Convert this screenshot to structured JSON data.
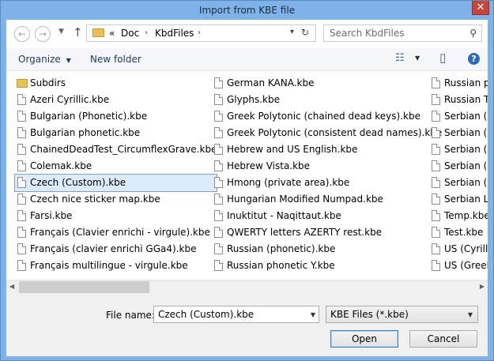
{
  "window": {
    "title": "Import from KBE file",
    "close_glyph": "✕"
  },
  "nav": {
    "back_glyph": "←",
    "forward_glyph": "→",
    "dropdown_glyph": "▼",
    "up_glyph": "↑",
    "breadcrumb_prefix": "«",
    "breadcrumb": [
      "Doc",
      "KbdFiles"
    ],
    "crumb_sep": "›",
    "address_drop": "▾",
    "refresh_glyph": "↻",
    "search_placeholder": "Search KbdFiles",
    "search_glyph": "⚲"
  },
  "toolbar": {
    "organize_label": "Organize",
    "organize_arrow": "▼",
    "new_folder_label": "New folder",
    "view_glyph": "☷",
    "view_arrow": "▼",
    "pane_glyph": "▯",
    "help_glyph": "?"
  },
  "files": {
    "col1": [
      {
        "name": "Subdirs",
        "type": "folder"
      },
      {
        "name": "Azeri Cyrillic.kbe",
        "type": "file"
      },
      {
        "name": "Bulgarian (Phonetic).kbe",
        "type": "file"
      },
      {
        "name": "Bulgarian phonetic.kbe",
        "type": "file"
      },
      {
        "name": "ChainedDeadTest_CircumflexGrave.kbe",
        "type": "file"
      },
      {
        "name": "Colemak.kbe",
        "type": "file"
      },
      {
        "name": "Czech (Custom).kbe",
        "type": "file",
        "selected": true
      },
      {
        "name": "Czech nice sticker map.kbe",
        "type": "file"
      },
      {
        "name": "Farsi.kbe",
        "type": "file"
      },
      {
        "name": "Français (Clavier enrichi - virgule).kbe",
        "type": "file"
      },
      {
        "name": "Français (clavier enrichi GGa4).kbe",
        "type": "file"
      },
      {
        "name": "Français multilingue - virgule.kbe",
        "type": "file"
      }
    ],
    "col2": [
      {
        "name": "German KANA.kbe",
        "type": "file"
      },
      {
        "name": "Glyphs.kbe",
        "type": "file"
      },
      {
        "name": "Greek Polytonic (chained dead keys).kbe",
        "type": "file"
      },
      {
        "name": "Greek Polytonic (consistent dead names).kbe",
        "type": "file"
      },
      {
        "name": "Hebrew and US English.kbe",
        "type": "file"
      },
      {
        "name": "Hebrew Vista.kbe",
        "type": "file"
      },
      {
        "name": "Hmong (private area).kbe",
        "type": "file"
      },
      {
        "name": "Hungarian Modified Numpad.kbe",
        "type": "file"
      },
      {
        "name": "Inuktitut - Naqittaut.kbe",
        "type": "file"
      },
      {
        "name": "QWERTY letters AZERTY rest.kbe",
        "type": "file"
      },
      {
        "name": "Russian (phonetic).kbe",
        "type": "file"
      },
      {
        "name": "Russian phonetic Y.kbe",
        "type": "file"
      }
    ],
    "col3": [
      {
        "name": "Russian pho",
        "type": "file"
      },
      {
        "name": "Russian Tes",
        "type": "file"
      },
      {
        "name": "Serbian (Cy",
        "type": "file"
      },
      {
        "name": "Serbian (Lat",
        "type": "file"
      },
      {
        "name": "Serbian (Lat",
        "type": "file"
      },
      {
        "name": "Serbian (Lat",
        "type": "file"
      },
      {
        "name": "Serbian (Lat",
        "type": "file"
      },
      {
        "name": "Serbian Lati",
        "type": "file"
      },
      {
        "name": "Temp.kbe",
        "type": "file"
      },
      {
        "name": "Test.kbe",
        "type": "file"
      },
      {
        "name": "US (Cyrillic",
        "type": "file"
      },
      {
        "name": "US (Greek o",
        "type": "file"
      }
    ]
  },
  "scroll": {
    "left_glyph": "◀",
    "right_glyph": "▶"
  },
  "footer": {
    "filename_label": "File name:",
    "filename_value": "Czech (Custom).kbe",
    "filter_value": "KBE Files (*.kbe)",
    "open_label": "Open",
    "cancel_label": "Cancel",
    "drop_glyph": "▼"
  }
}
